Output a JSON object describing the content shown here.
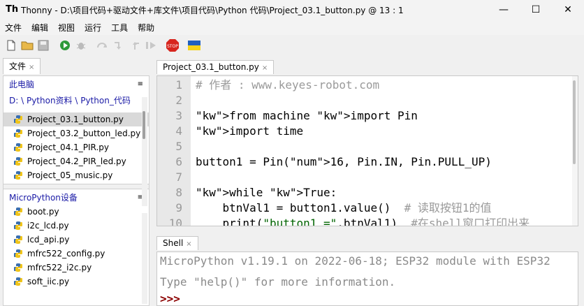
{
  "window": {
    "title": "Thonny  -  D:\\项目代码+驱动文件+库文件\\项目代码\\Python 代码\\Project_03.1_button.py  @  13 : 1",
    "minimize": "—",
    "maximize": "☐",
    "close": "✕"
  },
  "menu": [
    "文件",
    "编辑",
    "视图",
    "运行",
    "工具",
    "帮助"
  ],
  "files_tab": {
    "label": "文件",
    "close": "×"
  },
  "local": {
    "heading": "此电脑",
    "path": "D: \\ Python资料 \\ Python_代码",
    "items": [
      {
        "name": "Project_03.1_button.py",
        "selected": true
      },
      {
        "name": "Project_03.2_button_led.py"
      },
      {
        "name": "Project_04.1_PIR.py"
      },
      {
        "name": "Project_04.2_PIR_led.py"
      },
      {
        "name": "Project_05_music.py"
      }
    ]
  },
  "device": {
    "heading": "MicroPython设备",
    "items": [
      "boot.py",
      "i2c_lcd.py",
      "lcd_api.py",
      "mfrc522_config.py",
      "mfrc522_i2c.py",
      "soft_iic.py"
    ]
  },
  "editor_tab": {
    "label": "Project_03.1_button.py",
    "close": "×"
  },
  "code_lines": [
    {
      "n": "1",
      "text": "# 作者 : www.keyes-robot.com"
    },
    {
      "n": "2",
      "text": ""
    },
    {
      "n": "3",
      "text": "from machine import Pin"
    },
    {
      "n": "4",
      "text": "import time"
    },
    {
      "n": "5",
      "text": ""
    },
    {
      "n": "6",
      "text": "button1 = Pin(16, Pin.IN, Pin.PULL_UP)"
    },
    {
      "n": "7",
      "text": ""
    },
    {
      "n": "8",
      "text": "while True:"
    },
    {
      "n": "9",
      "text": "    btnVal1 = button1.value()  # 读取按钮1的值"
    },
    {
      "n": "10",
      "text": "    print(\"button1 =\",btnVal1)  #在shell窗口打印出来"
    }
  ],
  "shell_tab": {
    "label": "Shell",
    "close": "×"
  },
  "shell_lines": [
    "MicroPython v1.19.1 on 2022-06-18; ESP32 module with ESP32",
    "Type \"help()\" for more information.",
    ">>>"
  ],
  "colors": {
    "keyword": "#8b0000",
    "comment": "#9a9a9a",
    "number": "#008000",
    "selection": "#d9d9d9",
    "link": "#1a1aa6"
  },
  "toolbar_icons": [
    "new-file-icon",
    "open-folder-icon",
    "save-icon",
    "run-icon",
    "debug-icon",
    "step-over-icon",
    "step-into-icon",
    "step-out-icon",
    "resume-icon",
    "stop-icon",
    "ukraine-flag-icon"
  ],
  "stop_label": "STOP"
}
